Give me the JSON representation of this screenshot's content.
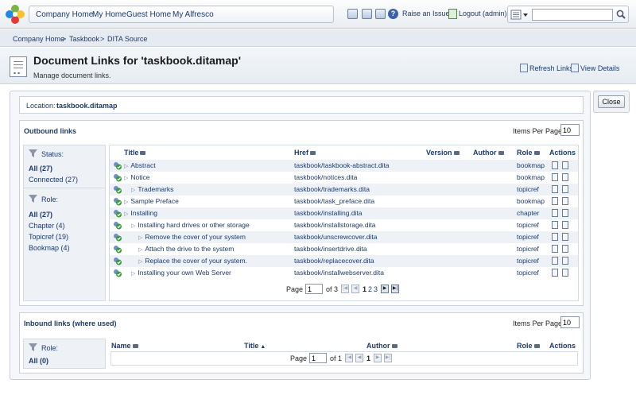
{
  "topbar": {
    "nav": [
      "Company Home",
      "My Home",
      "Guest Home",
      "My Alfresco"
    ],
    "raise_issue": "Raise an Issue",
    "logout": "Logout (admin)",
    "search_value": ""
  },
  "breadcrumb": [
    "Company Home",
    "Taskbook",
    "DITA Source"
  ],
  "breadcrumb_sep": ">",
  "header": {
    "title": "Document Links for 'taskbook.ditamap'",
    "subtitle": "Manage document links.",
    "refresh": "Refresh Links",
    "view_details": "View Details"
  },
  "close_label": "Close",
  "location": {
    "label": "Location:",
    "value": "taskbook.ditamap"
  },
  "outbound": {
    "title": "Outbound links",
    "ipp_label": "Items Per Page",
    "ipp_value": "10",
    "status_title": "Status:",
    "status_items": [
      "All (27)",
      "Connected (27)"
    ],
    "role_title": "Role:",
    "role_items": [
      "All (27)",
      "Chapter (4)",
      "Topicref (19)",
      "Bookmap (4)"
    ],
    "columns": {
      "title": "Title",
      "href": "Href",
      "version": "Version",
      "author": "Author",
      "role": "Role",
      "actions": "Actions"
    },
    "rows": [
      {
        "title": "Abstract",
        "href": "taskbook/taskbook-abstract.dita",
        "role": "bookmap"
      },
      {
        "title": "Notice",
        "href": "taskbook/notices.dita",
        "role": "bookmap"
      },
      {
        "title": "Trademarks",
        "href": "taskbook/trademarks.dita",
        "role": "topicref"
      },
      {
        "title": "Sample Preface",
        "href": "taskbook/task_preface.dita",
        "role": "bookmap"
      },
      {
        "title": "Installing",
        "href": "taskbook/installing.dita",
        "role": "chapter"
      },
      {
        "title": "Installing hard drives or other storage",
        "href": "taskbook/installstorage.dita",
        "role": "topicref"
      },
      {
        "title": "Remove the cover of your system",
        "href": "taskbook/unscrewcover.dita",
        "role": "topicref"
      },
      {
        "title": "Attach the drive to the system",
        "href": "taskbook/insertdrive.dita",
        "role": "topicref"
      },
      {
        "title": "Replace the cover of your system.",
        "href": "taskbook/replacecover.dita",
        "role": "topicref"
      },
      {
        "title": "Installing your own Web Server",
        "href": "taskbook/installwebserver.dita",
        "role": "topicref"
      }
    ],
    "pager": {
      "page_label": "Page",
      "page_value": "1",
      "of_label": "of 3",
      "pages": [
        "1",
        "2",
        "3"
      ]
    }
  },
  "inbound": {
    "title": "Inbound links (where used)",
    "ipp_label": "Items Per Page",
    "ipp_value": "10",
    "role_title": "Role:",
    "role_items": [
      "All (0)"
    ],
    "columns": {
      "name": "Name",
      "title": "Title",
      "author": "Author",
      "role": "Role",
      "actions": "Actions"
    },
    "pager": {
      "page_label": "Page",
      "page_value": "1",
      "of_label": "of 1"
    }
  }
}
